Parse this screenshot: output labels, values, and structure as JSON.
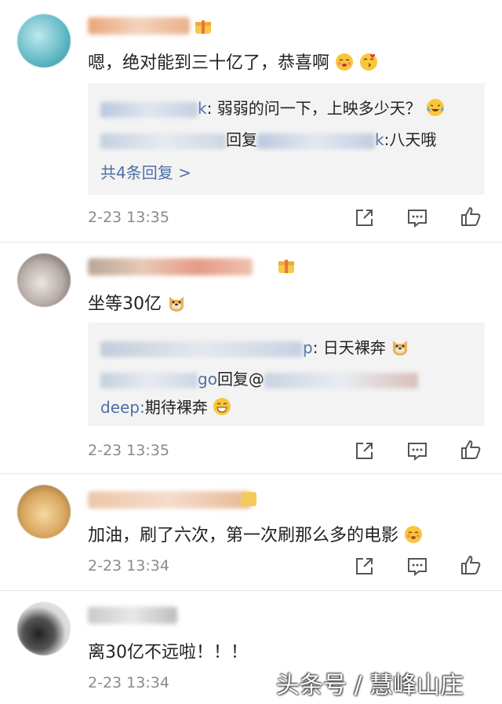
{
  "comments": [
    {
      "text": "嗯，绝对能到三十亿了，恭喜啊",
      "replies": [
        {
          "text_tail": ": 弱弱的问一下，上映多少天？"
        },
        {
          "reply_word": "回复",
          "text_tail": ":八天哦"
        }
      ],
      "more_replies": "共4条回复 >",
      "time": "2-23 13:35"
    },
    {
      "text": "坐等30亿",
      "replies": [
        {
          "text_tail": ": 日天裸奔"
        },
        {
          "prefix_tail": "go",
          "reply_word": "回复@",
          "line2": "deep:",
          "text_tail": "期待裸奔"
        }
      ],
      "time": "2-23 13:35"
    },
    {
      "text": "加油，刷了六次，第一次刷那么多的电影",
      "time": "2-23 13:34"
    },
    {
      "text": "离30亿不远啦！！！",
      "time": "2-23 13:34"
    }
  ],
  "actions": {
    "share_icon": "share-icon",
    "comment_icon": "comment-icon",
    "like_icon": "thumbs-up-icon"
  },
  "watermark": "头条号 / 慧峰山庄",
  "colors": {
    "link": "#4f6ea6",
    "meta": "#8a8a8a",
    "reply_bg": "#f3f3f3"
  }
}
